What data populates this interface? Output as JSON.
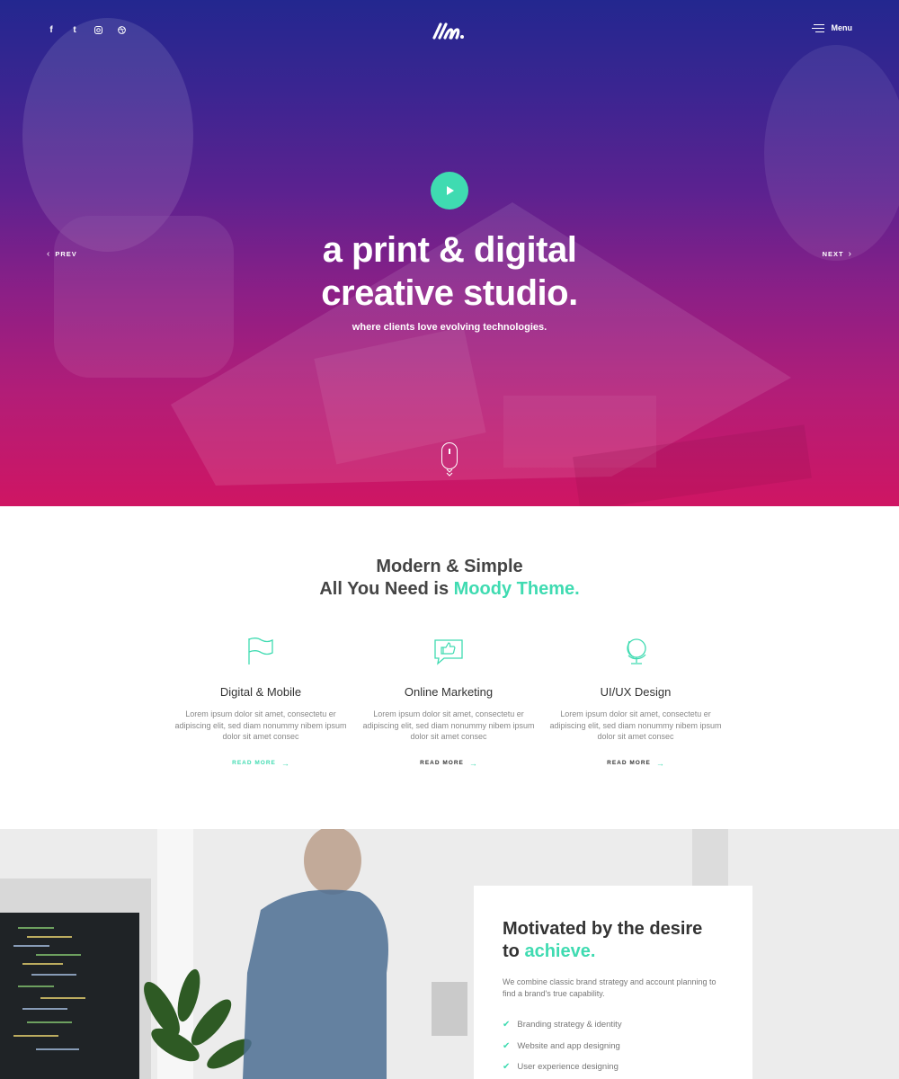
{
  "hero": {
    "social": [
      {
        "label": "f",
        "icon": "facebook-icon"
      },
      {
        "label": "t",
        "icon": "twitter-icon"
      },
      {
        "label": "ig",
        "icon": "instagram-icon"
      },
      {
        "label": "d",
        "icon": "dribbble-icon"
      }
    ],
    "menu_label": "Menu",
    "title_line1": "a print & digital",
    "title_line2": "creative studio.",
    "subtitle": "where clients love evolving technologies.",
    "prev_label": "PREV",
    "next_label": "NEXT",
    "accent_color": "#3fdbb1"
  },
  "features": {
    "heading_line1": "Modern & Simple",
    "heading_line2_prefix": "All You Need is",
    "heading_line2_accent": "Moody Theme.",
    "items": [
      {
        "title": "Digital & Mobile",
        "text": "Lorem ipsum dolor sit amet, consectetu er adipiscing elit, sed diam nonummy nibem ipsum dolor sit amet consec",
        "link": "READ MORE",
        "icon": "flag-icon"
      },
      {
        "title": "Online Marketing",
        "text": "Lorem ipsum dolor sit amet, consectetu er adipiscing elit, sed diam nonummy nibem ipsum dolor sit amet consec",
        "link": "READ MORE",
        "icon": "thumbs-up-chat-icon"
      },
      {
        "title": "UI/UX Design",
        "text": "Lorem ipsum dolor sit amet, consectetu er adipiscing elit, sed diam nonummy nibem ipsum dolor sit amet consec",
        "link": "READ MORE",
        "icon": "globe-icon"
      }
    ]
  },
  "about": {
    "title_line1": "Motivated by the desire",
    "title_line2_prefix": "to",
    "title_line2_accent": "achieve.",
    "description": "We combine classic brand strategy and account planning to find a brand's true capability.",
    "list": [
      "Branding strategy & identity",
      "Website and app designing",
      "User experience designing"
    ]
  }
}
